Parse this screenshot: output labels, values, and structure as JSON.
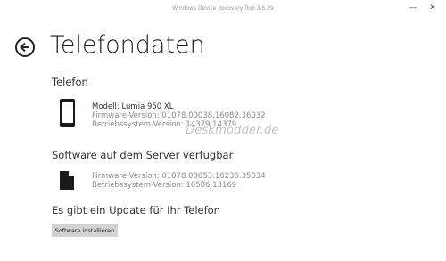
{
  "window": {
    "title": "Windows Device Recovery Tool 3.6.39",
    "minimize_glyph": "—",
    "close_glyph": "✕"
  },
  "page": {
    "title": "Telefondaten"
  },
  "phone_section": {
    "title": "Telefon",
    "icon": "phone-icon",
    "model": "Modell: Lumia 950 XL",
    "firmware": "Firmware-Version: 01078.00038.16082.36032",
    "os": "Betriebssystem-Version: 14379.14379"
  },
  "server_section": {
    "title": "Software auf dem Server verfügbar",
    "icon": "document-icon",
    "firmware": "Firmware-Version: 01078.00053.16236.35034",
    "os": "Betriebssystem-Version: 10586.13169"
  },
  "update_section": {
    "title": "Es gibt ein Update für Ihr Telefon",
    "button_label": "Software installieren"
  },
  "watermark": "Deskmodder.de"
}
